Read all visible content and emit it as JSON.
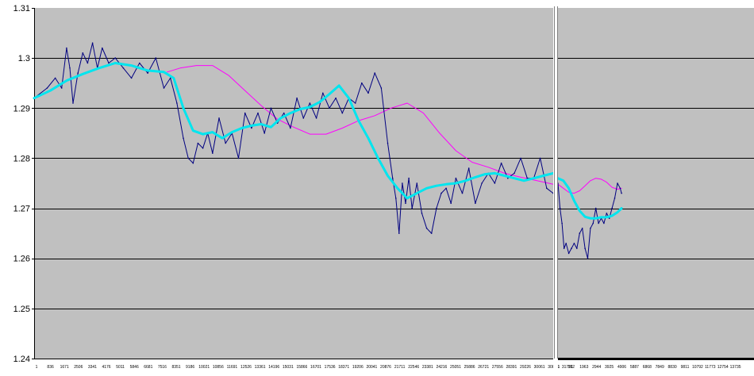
{
  "colors": {
    "plot_bg": "#c0c0c0",
    "gridline": "#000000",
    "price": "#000080",
    "ma_fast": "#00e5ee",
    "ma_slow": "#ff00ff",
    "separator": "#ffffff"
  },
  "chart_data": [
    {
      "type": "line",
      "title": "",
      "xlabel": "",
      "ylabel": "",
      "ylim": [
        1.24,
        1.31
      ],
      "yticks": [
        "1.24",
        "1.25",
        "1.26",
        "1.27",
        "1.28",
        "1.29",
        "1.3",
        "1.31"
      ],
      "xticks": [
        "1",
        "836",
        "1671",
        "2506",
        "3341",
        "4176",
        "5011",
        "5846",
        "6681",
        "7516",
        "8351",
        "9186",
        "10021",
        "10856",
        "11691",
        "12526",
        "13361",
        "14196",
        "15031",
        "15866",
        "16701",
        "17536",
        "18371",
        "19206",
        "20041",
        "20876",
        "21711",
        "22546",
        "23381",
        "24216",
        "25051",
        "25886",
        "26721",
        "27556",
        "28391",
        "29226",
        "30061",
        "30896",
        "31731"
      ],
      "grid": true,
      "series": [
        {
          "color": "#000080",
          "x": [
            1,
            800,
            1300,
            1700,
            2000,
            2200,
            2400,
            2700,
            3000,
            3300,
            3600,
            3900,
            4200,
            4600,
            5000,
            5500,
            6000,
            6500,
            7000,
            7500,
            8000,
            8400,
            8800,
            9200,
            9500,
            9800,
            10100,
            10400,
            10700,
            11000,
            11400,
            11800,
            12200,
            12600,
            13000,
            13400,
            13800,
            14200,
            14600,
            15000,
            15400,
            15800,
            16200,
            16600,
            17000,
            17400,
            17800,
            18200,
            18600,
            19000,
            19400,
            19800,
            20200,
            20600,
            21000,
            21400,
            21800,
            22100,
            22300,
            22500,
            22700,
            22900,
            23100,
            23300,
            23600,
            23900,
            24200,
            24500,
            24800,
            25100,
            25400,
            25700,
            26000,
            26400,
            26800,
            27200,
            27600,
            28000,
            28400,
            28800,
            29200,
            29600,
            30000,
            30400,
            30800,
            31200,
            31600,
            32000
          ],
          "values": [
            1.292,
            1.294,
            1.296,
            1.294,
            1.302,
            1.298,
            1.291,
            1.297,
            1.301,
            1.299,
            1.303,
            1.298,
            1.302,
            1.299,
            1.3,
            1.298,
            1.296,
            1.299,
            1.297,
            1.3,
            1.294,
            1.296,
            1.291,
            1.284,
            1.28,
            1.279,
            1.283,
            1.282,
            1.285,
            1.281,
            1.288,
            1.283,
            1.285,
            1.28,
            1.289,
            1.286,
            1.289,
            1.285,
            1.29,
            1.287,
            1.289,
            1.286,
            1.292,
            1.288,
            1.291,
            1.288,
            1.293,
            1.29,
            1.292,
            1.289,
            1.292,
            1.291,
            1.295,
            1.293,
            1.297,
            1.294,
            1.283,
            1.276,
            1.272,
            1.265,
            1.275,
            1.271,
            1.276,
            1.27,
            1.275,
            1.269,
            1.266,
            1.265,
            1.27,
            1.273,
            1.274,
            1.271,
            1.276,
            1.273,
            1.278,
            1.271,
            1.275,
            1.277,
            1.275,
            1.279,
            1.276,
            1.277,
            1.28,
            1.276,
            1.276,
            1.28,
            1.274,
            1.273
          ]
        },
        {
          "color": "#00e5ee",
          "x": [
            1,
            1000,
            2000,
            3000,
            4000,
            5000,
            6000,
            7000,
            8000,
            8600,
            9200,
            9800,
            10400,
            11000,
            11600,
            12200,
            12800,
            13400,
            14000,
            14600,
            15200,
            15800,
            16400,
            17000,
            17600,
            18200,
            18800,
            19400,
            20000,
            20600,
            21200,
            21800,
            22400,
            23000,
            23600,
            24200,
            24800,
            25400,
            26000,
            26600,
            27200,
            27800,
            28400,
            29000,
            29600,
            30200,
            30800,
            31400,
            32000
          ],
          "values": [
            1.292,
            1.2935,
            1.2955,
            1.2968,
            1.298,
            1.299,
            1.2985,
            1.2975,
            1.2972,
            1.296,
            1.29,
            1.2855,
            1.2848,
            1.2852,
            1.284,
            1.2852,
            1.286,
            1.2865,
            1.2868,
            1.2862,
            1.288,
            1.289,
            1.2898,
            1.2902,
            1.2912,
            1.2928,
            1.2945,
            1.292,
            1.2875,
            1.284,
            1.28,
            1.2765,
            1.274,
            1.272,
            1.273,
            1.274,
            1.2745,
            1.2748,
            1.275,
            1.2755,
            1.2762,
            1.2768,
            1.277,
            1.2765,
            1.276,
            1.2755,
            1.276,
            1.2765,
            1.277
          ]
        },
        {
          "color": "#ff00ff",
          "x": [
            8200,
            9000,
            10000,
            11000,
            12000,
            13000,
            14000,
            15000,
            16000,
            17000,
            18000,
            19000,
            20000,
            21000,
            22000,
            23000,
            24000,
            25000,
            26000,
            27000,
            28000,
            29000,
            30000,
            31000,
            32000
          ],
          "values": [
            1.2972,
            1.298,
            1.2985,
            1.2985,
            1.2965,
            1.2935,
            1.2905,
            1.2878,
            1.2862,
            1.2848,
            1.2848,
            1.286,
            1.2875,
            1.2885,
            1.29,
            1.291,
            1.289,
            1.285,
            1.2815,
            1.2792,
            1.2782,
            1.277,
            1.2762,
            1.2755,
            1.2748
          ]
        }
      ]
    },
    {
      "type": "line",
      "title": "",
      "xlabel": "",
      "ylabel": "",
      "ylim": [
        1.24,
        1.31
      ],
      "xticks": [
        "1",
        "992",
        "1963",
        "2944",
        "3925",
        "4906",
        "5887",
        "6868",
        "7849",
        "8830",
        "9811",
        "10792",
        "11773",
        "12754",
        "13735"
      ],
      "grid": true,
      "series": [
        {
          "color": "#000080",
          "x": [
            1,
            150,
            300,
            450,
            600,
            800,
            1000,
            1200,
            1400,
            1600,
            1800,
            2000,
            2200,
            2400,
            2600,
            2800,
            3000,
            3200,
            3400,
            3600,
            3800,
            4000,
            4200,
            4400,
            4600,
            4700
          ],
          "values": [
            1.275,
            1.27,
            1.267,
            1.262,
            1.263,
            1.261,
            1.262,
            1.263,
            1.262,
            1.265,
            1.266,
            1.262,
            1.26,
            1.266,
            1.267,
            1.27,
            1.267,
            1.268,
            1.267,
            1.269,
            1.268,
            1.27,
            1.272,
            1.275,
            1.274,
            1.273
          ]
        },
        {
          "color": "#00e5ee",
          "x": [
            1,
            400,
            800,
            1200,
            1600,
            2000,
            2400,
            2800,
            3200,
            3600,
            4000,
            4400,
            4700
          ],
          "values": [
            1.276,
            1.2755,
            1.274,
            1.2715,
            1.2695,
            1.2683,
            1.268,
            1.268,
            1.2682,
            1.2682,
            1.2685,
            1.2692,
            1.27
          ]
        },
        {
          "color": "#ff00ff",
          "x": [
            1,
            400,
            800,
            1200,
            1600,
            2000,
            2400,
            2800,
            3200,
            3600,
            4000,
            4400,
            4700
          ],
          "values": [
            1.2748,
            1.274,
            1.2732,
            1.273,
            1.2735,
            1.2745,
            1.2755,
            1.276,
            1.2758,
            1.2752,
            1.2742,
            1.2738,
            1.274
          ]
        }
      ]
    }
  ]
}
